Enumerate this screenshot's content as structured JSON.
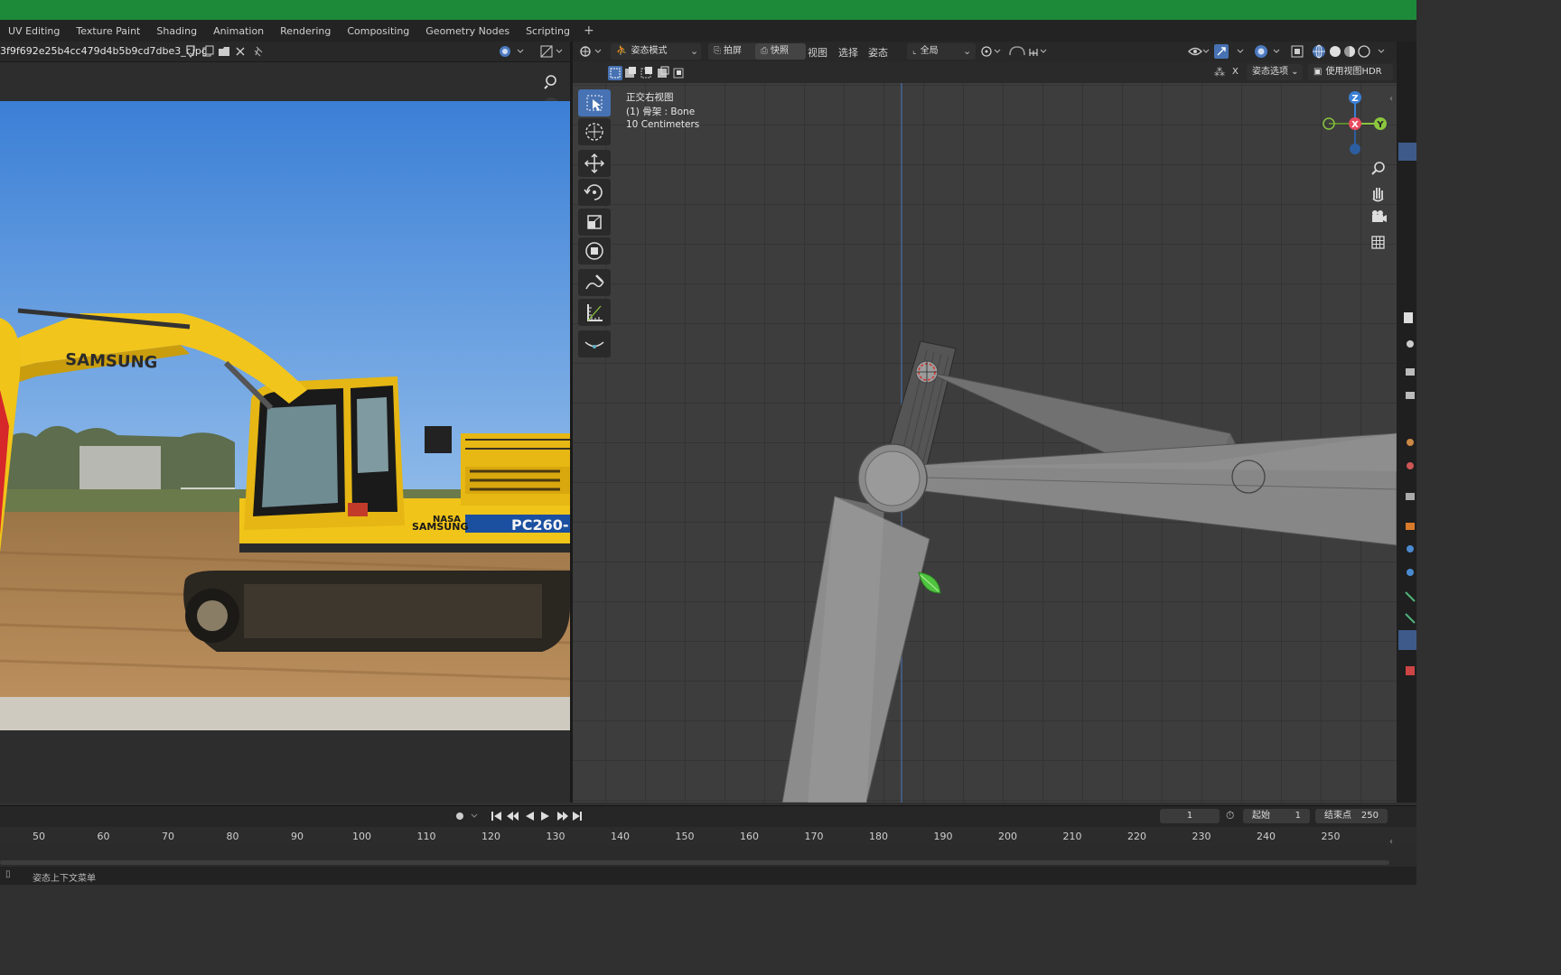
{
  "workspace_tabs": [
    "UV Editing",
    "Texture Paint",
    "Shading",
    "Animation",
    "Rendering",
    "Compositing",
    "Geometry Nodes",
    "Scripting",
    "+"
  ],
  "image_editor": {
    "filename": "3f9f692e25b4cc479d4b5b9cd7dbe3_r.jpg",
    "photo_texts": {
      "boom_brand": "SAMSUNG",
      "body_brand": "SAMSUNG",
      "body_sub": "NASA",
      "model": "PC260-"
    }
  },
  "viewport": {
    "header": {
      "mode": "姿态模式",
      "menu_items": [
        "拍屏",
        "快照",
        "视图",
        "选择",
        "姿态"
      ],
      "transform_orientation": "全局"
    },
    "subheader": {
      "x_label": "X",
      "pose_options": "姿态选项",
      "hdr_label": "使用视图HDR"
    },
    "overlay": {
      "view_name": "正交右视图",
      "object_info": "(1) 骨架 : Bone",
      "scale": "10 Centimeters"
    },
    "gizmo": {
      "z": "Z",
      "x": "X",
      "y": "Y"
    },
    "colors": {
      "x": "#e84a5f",
      "y": "#8bc63f",
      "z": "#3a7fd6",
      "active_tool": "#4772b3"
    }
  },
  "timeline": {
    "current_frame": "1",
    "start_label": "起始",
    "start_value": "1",
    "end_label": "结束点",
    "end_value": "250",
    "ruler": [
      "50",
      "60",
      "70",
      "80",
      "90",
      "100",
      "110",
      "120",
      "130",
      "140",
      "150",
      "160",
      "170",
      "180",
      "190",
      "200",
      "210",
      "220",
      "230",
      "240",
      "250"
    ]
  },
  "status": {
    "text": "姿态上下文菜单"
  }
}
